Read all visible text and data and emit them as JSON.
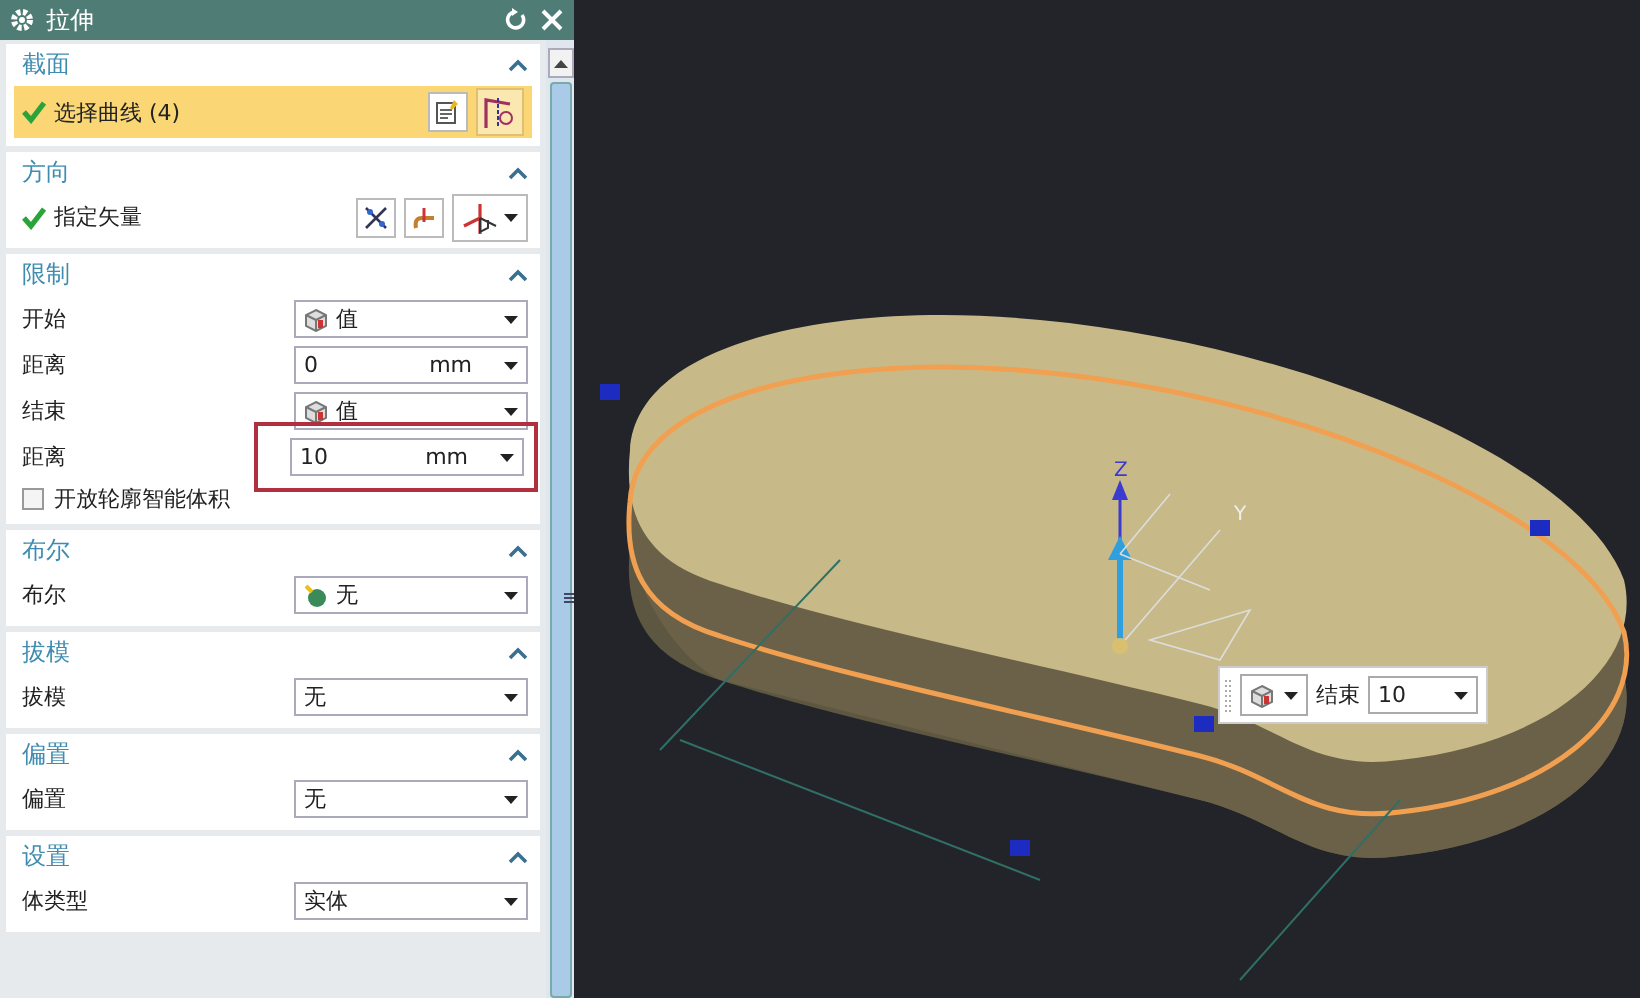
{
  "dialog": {
    "title": "拉伸",
    "sections": [
      {
        "title": "截面",
        "expanded": true,
        "rows": [
          {
            "kind": "selection",
            "label": "选择曲线 (4)",
            "done": true,
            "selected": true
          }
        ]
      },
      {
        "title": "方向",
        "expanded": true,
        "rows": [
          {
            "kind": "vector",
            "label": "指定矢量",
            "done": true
          }
        ]
      },
      {
        "title": "限制",
        "expanded": true,
        "rows": [
          {
            "kind": "cube-dropdown",
            "label": "开始",
            "value": "值"
          },
          {
            "kind": "number",
            "label": "距离",
            "value": "0",
            "unit": "mm",
            "highlighted": false
          },
          {
            "kind": "cube-dropdown",
            "label": "结束",
            "value": "值"
          },
          {
            "kind": "number",
            "label": "距离",
            "value": "10",
            "unit": "mm",
            "highlighted": true
          },
          {
            "kind": "checkbox",
            "label": "开放轮廓智能体积",
            "checked": false
          }
        ]
      },
      {
        "title": "布尔",
        "expanded": true,
        "rows": [
          {
            "kind": "ball-dropdown",
            "label": "布尔",
            "value": "无"
          }
        ]
      },
      {
        "title": "拔模",
        "expanded": true,
        "rows": [
          {
            "kind": "dropdown",
            "label": "拔模",
            "value": "无"
          }
        ]
      },
      {
        "title": "偏置",
        "expanded": true,
        "rows": [
          {
            "kind": "dropdown",
            "label": "偏置",
            "value": "无"
          }
        ]
      },
      {
        "title": "设置",
        "expanded": true,
        "rows": [
          {
            "kind": "dropdown",
            "label": "体类型",
            "value": "实体"
          }
        ]
      }
    ]
  },
  "viewport": {
    "axis_labels": [
      "Z",
      "Y"
    ],
    "toolbar": {
      "label": "结束",
      "value": "10"
    }
  }
}
